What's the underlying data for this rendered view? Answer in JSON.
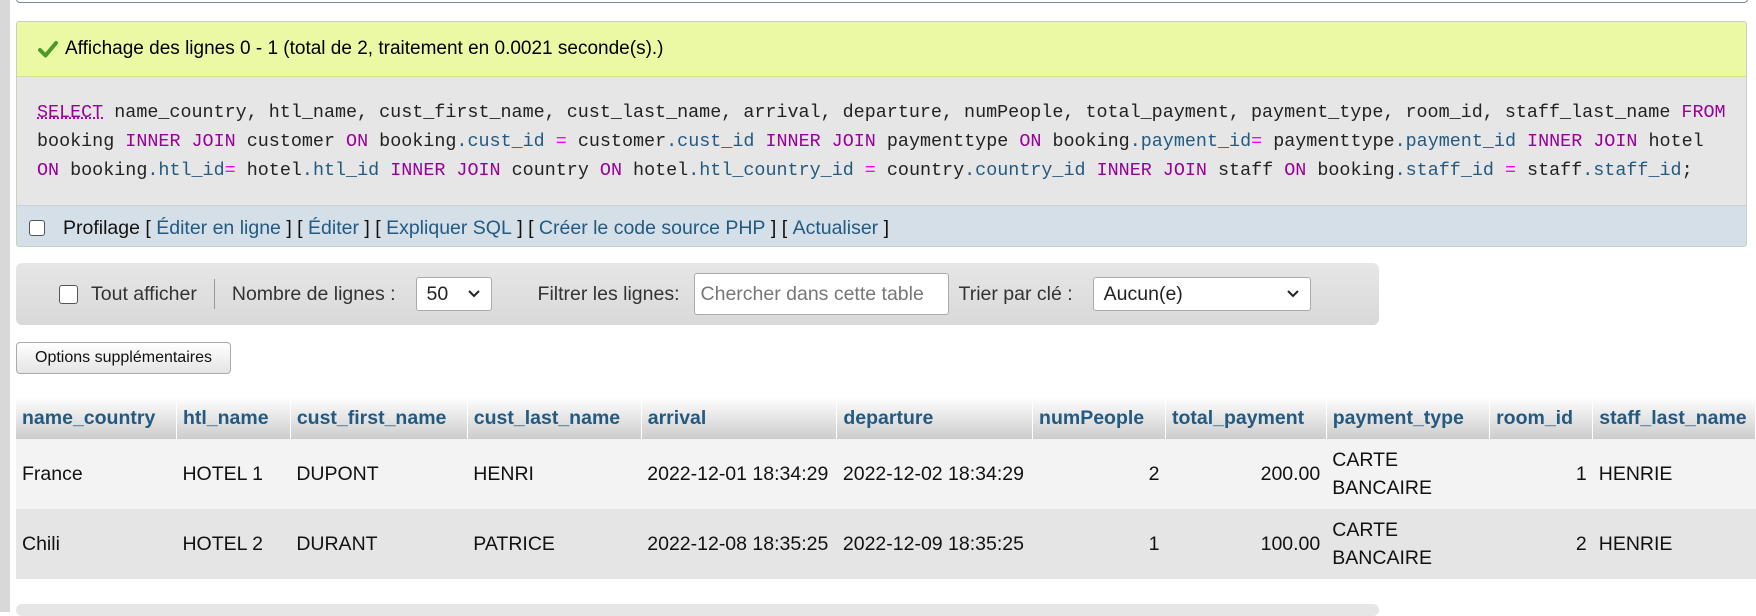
{
  "success_message": "Affichage des lignes 0 - 1 (total de 2, traitement en 0.0021 seconde(s).)",
  "sql": {
    "parts": [
      {
        "t": "SELECT",
        "c": "kw sel"
      },
      {
        "t": " name_country, htl_name, cust_first_name, cust_last_name, arrival, departure, numPeople, total_payment, payment_type, room_id, staff_last_name ",
        "c": ""
      },
      {
        "t": "FROM",
        "c": "kw"
      },
      {
        "t": " booking ",
        "c": ""
      },
      {
        "t": "INNER JOIN",
        "c": "kw"
      },
      {
        "t": " customer ",
        "c": ""
      },
      {
        "t": "ON",
        "c": "kw"
      },
      {
        "t": " booking",
        "c": ""
      },
      {
        "t": ".cust_id",
        "c": "fld"
      },
      {
        "t": " = ",
        "c": "op"
      },
      {
        "t": "customer",
        "c": ""
      },
      {
        "t": ".cust_id",
        "c": "fld"
      },
      {
        "t": " ",
        "c": ""
      },
      {
        "t": "INNER JOIN",
        "c": "kw"
      },
      {
        "t": " paymenttype ",
        "c": ""
      },
      {
        "t": "ON",
        "c": "kw"
      },
      {
        "t": " booking",
        "c": ""
      },
      {
        "t": ".payment_id",
        "c": "fld"
      },
      {
        "t": "=",
        "c": "op"
      },
      {
        "t": " paymenttype",
        "c": ""
      },
      {
        "t": ".payment_id",
        "c": "fld"
      },
      {
        "t": " ",
        "c": ""
      },
      {
        "t": "INNER JOIN",
        "c": "kw"
      },
      {
        "t": " hotel ",
        "c": ""
      },
      {
        "t": "ON",
        "c": "kw"
      },
      {
        "t": " booking",
        "c": ""
      },
      {
        "t": ".htl_id",
        "c": "fld"
      },
      {
        "t": "=",
        "c": "op"
      },
      {
        "t": " hotel",
        "c": ""
      },
      {
        "t": ".htl_id",
        "c": "fld"
      },
      {
        "t": " ",
        "c": ""
      },
      {
        "t": "INNER JOIN",
        "c": "kw"
      },
      {
        "t": " country ",
        "c": ""
      },
      {
        "t": "ON",
        "c": "kw"
      },
      {
        "t": " hotel",
        "c": ""
      },
      {
        "t": ".htl_country_id",
        "c": "fld"
      },
      {
        "t": " = ",
        "c": "op"
      },
      {
        "t": "country",
        "c": ""
      },
      {
        "t": ".country_id",
        "c": "fld"
      },
      {
        "t": " ",
        "c": ""
      },
      {
        "t": "INNER JOIN",
        "c": "kw"
      },
      {
        "t": " staff ",
        "c": ""
      },
      {
        "t": "ON",
        "c": "kw"
      },
      {
        "t": " booking",
        "c": ""
      },
      {
        "t": ".staff_id",
        "c": "fld"
      },
      {
        "t": " = ",
        "c": "op"
      },
      {
        "t": "staff",
        "c": ""
      },
      {
        "t": ".staff_id",
        "c": "fld"
      },
      {
        "t": ";",
        "c": ""
      }
    ]
  },
  "tools": {
    "profiling_label": "Profilage",
    "bracket_open": "[",
    "bracket_close": "]",
    "edit_inline": "Éditer en ligne",
    "edit": "Éditer",
    "explain": "Expliquer SQL",
    "php_code": "Créer le code source PHP",
    "refresh": "Actualiser"
  },
  "nav": {
    "show_all_label": "Tout afficher",
    "rows_label": "Nombre de lignes :",
    "rows_value": "50",
    "filter_label": "Filtrer les lignes:",
    "filter_placeholder": "Chercher dans cette table",
    "sort_label": "Trier par clé :",
    "sort_value": "Aucun(e)"
  },
  "options_button": "Options supplémentaires",
  "table": {
    "columns": [
      "name_country",
      "htl_name",
      "cust_first_name",
      "cust_last_name",
      "arrival",
      "departure",
      "numPeople",
      "total_payment",
      "payment_type",
      "room_id",
      "staff_last_name"
    ],
    "rows": [
      [
        "France",
        "HOTEL 1",
        "DUPONT",
        "HENRI",
        "2022-12-01 18:34:29",
        "2022-12-02 18:34:29",
        "2",
        "200.00",
        "CARTE BANCAIRE",
        "1",
        "HENRIE"
      ],
      [
        "Chili",
        "HOTEL 2",
        "DURANT",
        "PATRICE",
        "2022-12-08 18:35:25",
        "2022-12-09 18:35:25",
        "1",
        "100.00",
        "CARTE BANCAIRE",
        "2",
        "HENRIE"
      ]
    ]
  },
  "colors": {
    "success_bg": "#ebf8a4",
    "link": "#235a81",
    "keyword": "#990099",
    "operator": "#ff00ff"
  }
}
